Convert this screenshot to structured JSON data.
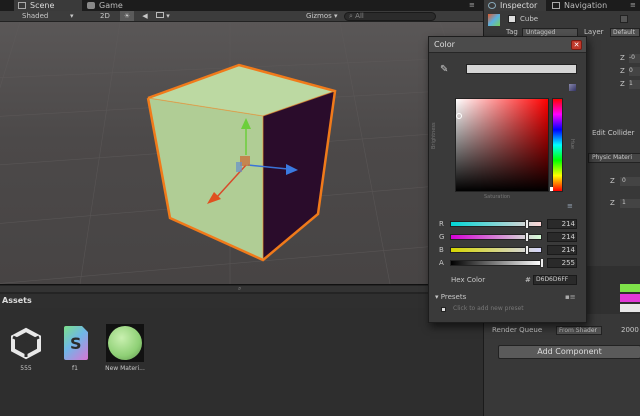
{
  "tabs": {
    "scene": "Scene",
    "game": "Game",
    "inspector": "Inspector",
    "navigation": "Navigation"
  },
  "scene_toolbar": {
    "shading_mode": "Shaded",
    "mode_2d": "2D",
    "gizmos": "Gizmos",
    "search_placeholder": "All"
  },
  "assets": {
    "header": "Assets",
    "items": [
      {
        "name": "555",
        "icon": "unity-logo-icon"
      },
      {
        "name": "f1",
        "icon": "shader-file-icon"
      },
      {
        "name": "New Materi...",
        "icon": "material-sphere-icon"
      }
    ]
  },
  "inspector": {
    "object_name": "Cube",
    "tag_label": "Tag",
    "tag_value": "Untagged",
    "layer_label": "Layer",
    "layer_value": "Default",
    "z_rows": [
      {
        "label": "Z",
        "value": "-0"
      },
      {
        "label": "Z",
        "value": "0"
      },
      {
        "label": "Z",
        "value": "1"
      }
    ],
    "edit_collider": "Edit Collider",
    "physic_material": "Physic Materi",
    "z_rows_2": [
      {
        "label": "Z",
        "value": "0"
      },
      {
        "label": "Z",
        "value": "1"
      }
    ],
    "render_queue_label": "Render Queue",
    "render_queue_mode": "From Shader",
    "render_queue_value": "2000",
    "add_component": "Add Component"
  },
  "color_picker": {
    "title": "Color",
    "brightness_label": "Brightness",
    "saturation_label": "Saturation",
    "hue_label": "Hue",
    "channels": [
      {
        "label": "R",
        "value": "214",
        "fraction": 0.839
      },
      {
        "label": "G",
        "value": "214",
        "fraction": 0.839
      },
      {
        "label": "B",
        "value": "214",
        "fraction": 0.839
      },
      {
        "label": "A",
        "value": "255",
        "fraction": 1.0
      }
    ],
    "hex_label": "Hex Color",
    "hex_prefix": "#",
    "hex_value": "D6D6D6FF",
    "presets_label": "Presets",
    "add_preset": "Click to add new preset"
  },
  "colors": {
    "cube_front": "#b5d59a",
    "cube_side": "#2a0d2a",
    "selection_outline": "#f07a1a",
    "panel_bg": "#383838",
    "viewport_bg": "#4a4747"
  }
}
